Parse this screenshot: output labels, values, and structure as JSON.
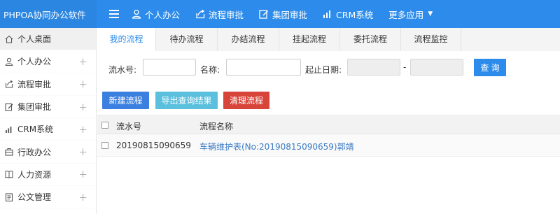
{
  "app": {
    "title": "PHPOA协同办公软件"
  },
  "topnav": [
    {
      "label": "个人办公",
      "icon": "user-icon"
    },
    {
      "label": "流程审批",
      "icon": "flow-icon"
    },
    {
      "label": "集团审批",
      "icon": "edit-icon"
    },
    {
      "label": "CRM系统",
      "icon": "chart-icon"
    },
    {
      "label": "更多应用",
      "icon": "caret-down-icon"
    }
  ],
  "sidebar": {
    "items": [
      {
        "label": "个人桌面",
        "icon": "home-icon",
        "expandable": false,
        "active": true
      },
      {
        "label": "个人办公",
        "icon": "user-icon",
        "expandable": true
      },
      {
        "label": "流程审批",
        "icon": "flow-icon",
        "expandable": true
      },
      {
        "label": "集团审批",
        "icon": "edit-icon",
        "expandable": true
      },
      {
        "label": "CRM系统",
        "icon": "chart-icon",
        "expandable": true
      },
      {
        "label": "行政办公",
        "icon": "briefcase-icon",
        "expandable": true
      },
      {
        "label": "人力资源",
        "icon": "book-icon",
        "expandable": true
      },
      {
        "label": "公文管理",
        "icon": "document-icon",
        "expandable": true
      }
    ],
    "expand_symbol": "+"
  },
  "tabs": [
    {
      "label": "我的流程",
      "active": true
    },
    {
      "label": "待办流程"
    },
    {
      "label": "办结流程"
    },
    {
      "label": "挂起流程"
    },
    {
      "label": "委托流程"
    },
    {
      "label": "流程监控"
    }
  ],
  "search": {
    "serial_label": "流水号:",
    "serial_value": "",
    "name_label": "名称:",
    "name_value": "",
    "date_label": "起止日期:",
    "date_start": "",
    "date_end": "",
    "date_separator": "-",
    "query_button": "查 询"
  },
  "actions": {
    "new_flow": "新建流程",
    "export_results": "导出查询结果",
    "clean_flow": "清理流程"
  },
  "table": {
    "columns": [
      "流水号",
      "流程名称"
    ],
    "rows": [
      {
        "serial": "20190815090659",
        "name": "车辆维护表(No:20190815090659)郭靖"
      }
    ]
  },
  "colors": {
    "topbar": "#2d8ceb",
    "primary": "#2d8ceb",
    "info": "#5bc0de",
    "danger": "#d9443a",
    "link": "#3b7bc4"
  }
}
